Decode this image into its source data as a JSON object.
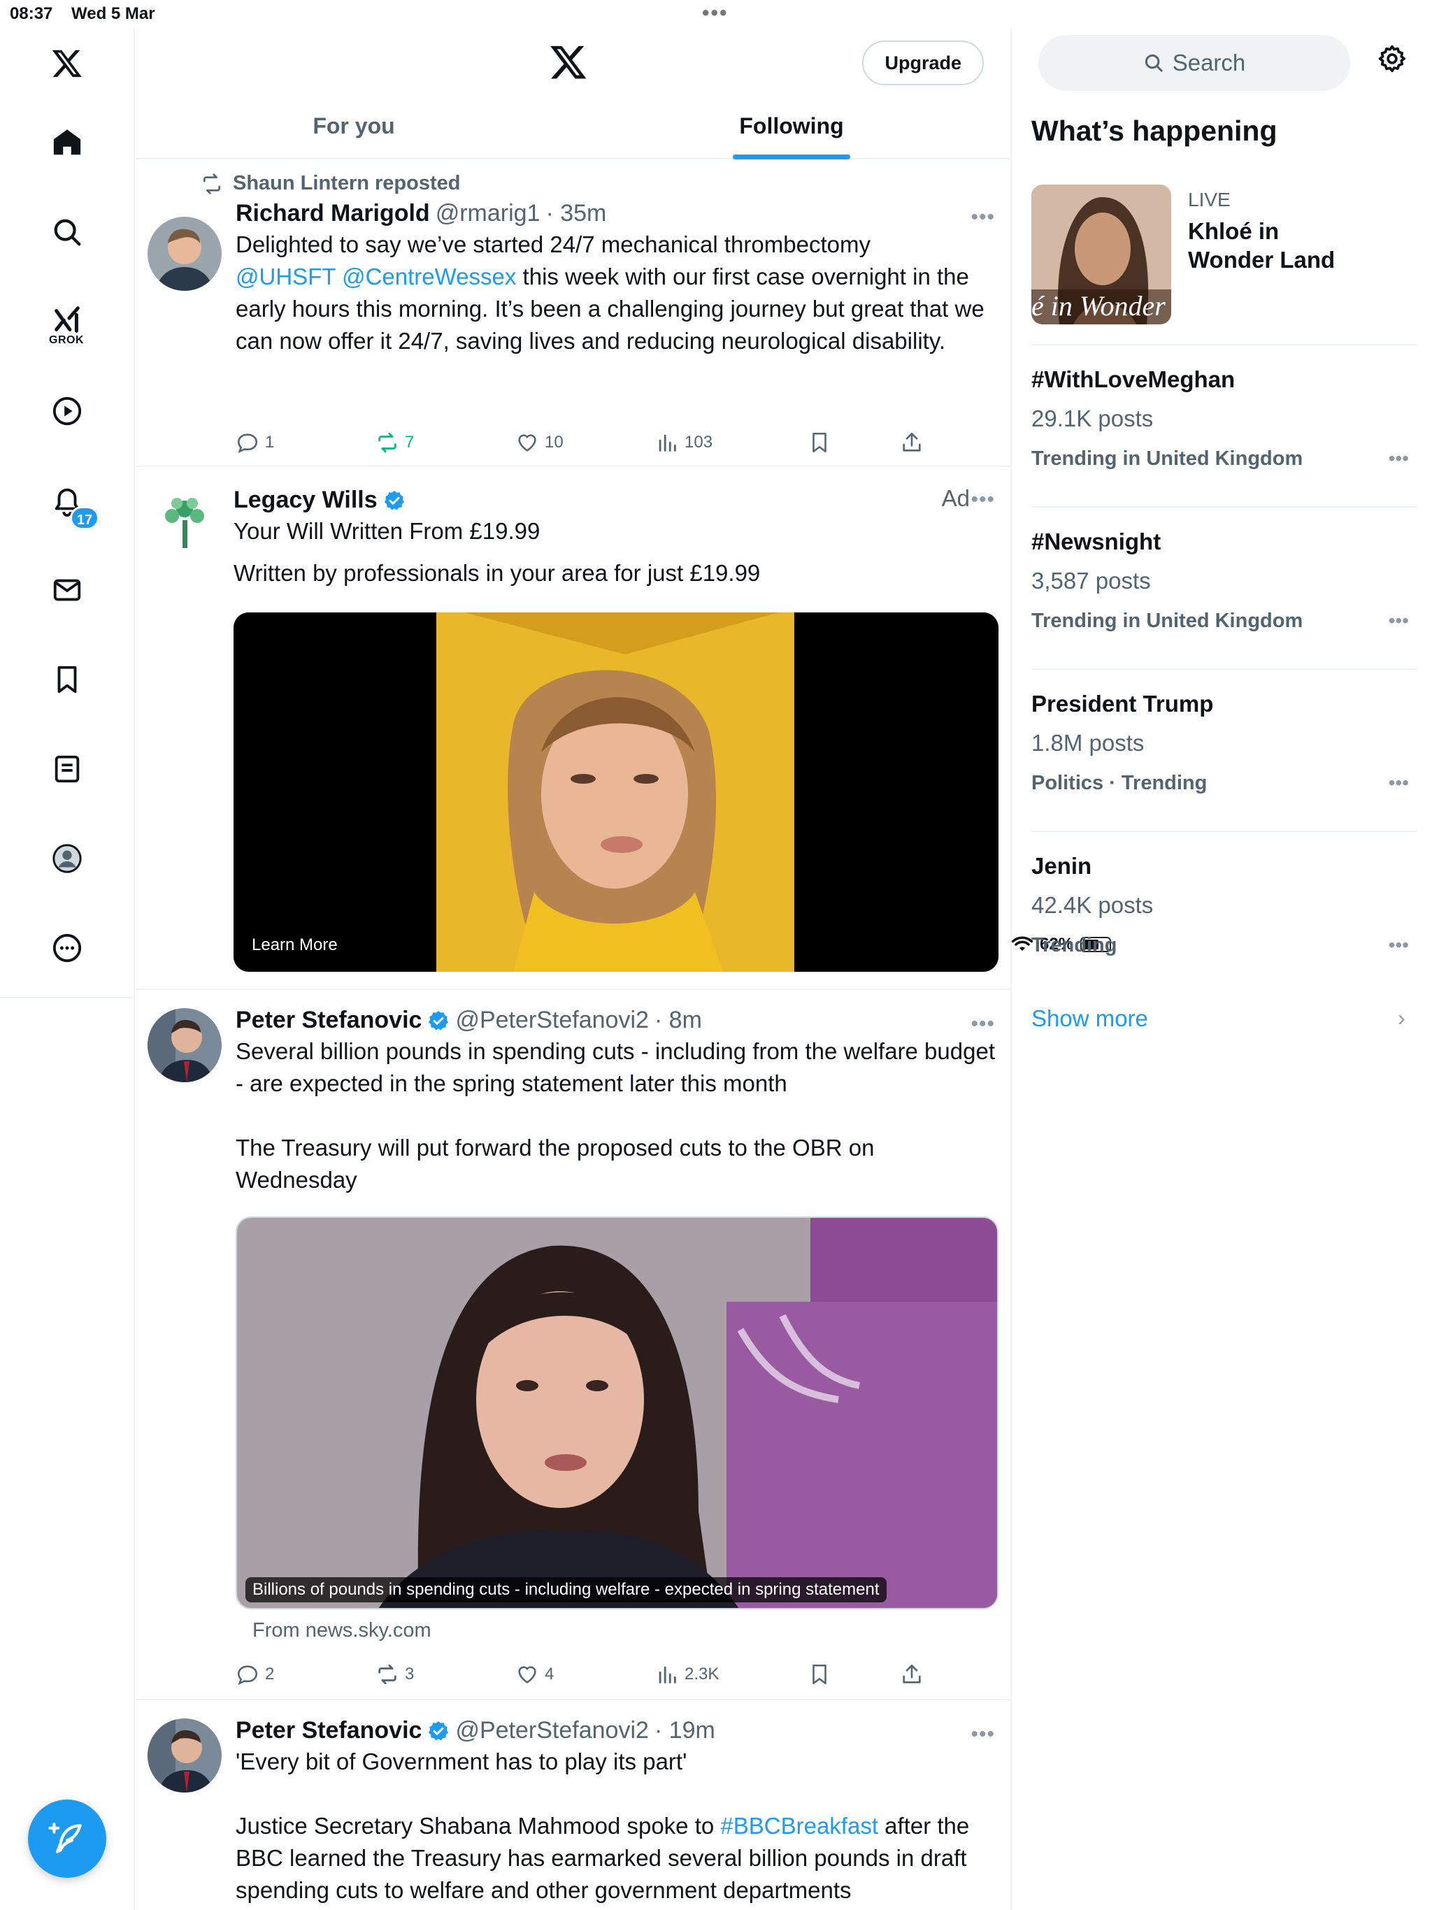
{
  "status": {
    "time": "08:37",
    "date": "Wed 5 Mar",
    "battery": "62%",
    "battery_level": 0.62
  },
  "nav": {
    "grok_label": "GROK",
    "notifications_badge": "17"
  },
  "header": {
    "upgrade_label": "Upgrade"
  },
  "tabs": [
    {
      "label": "For you"
    },
    {
      "label": "Following"
    }
  ],
  "tweets": [
    {
      "repost_by": "Shaun Lintern reposted",
      "name": "Richard Marigold",
      "handle": "@rmarig1",
      "time": "· 35m",
      "text_a": "Delighted to say we’ve started 24/7 mechanical thrombectomy",
      "mention1": "@UHSFT",
      "mention2": "@CentreWessex",
      "text_b": " this week with our first case overnight in the early hours this morning. It’s been a challenging journey but great that we can now offer it 24/7, saving lives and reducing neurological disability.",
      "replies": "1",
      "reposts": "7",
      "likes": "10",
      "views": "103"
    },
    {
      "name": "Legacy Wills",
      "ad_label": "Ad",
      "headline": "Your Will Written From £19.99",
      "text": "Written by professionals in your area for just £19.99",
      "cta": "Learn More"
    },
    {
      "name": "Peter Stefanovic",
      "handle": "@PeterStefanovi2",
      "time": "· 8m",
      "text_a": "Several billion pounds in spending cuts - including from the welfare budget - are expected in the spring statement later this month",
      "text_b": "The Treasury will put forward the proposed cuts to the OBR on Wednesday",
      "media_caption": "Billions of pounds in spending cuts - including welfare - expected in spring statement",
      "source": "From news.sky.com",
      "replies": "2",
      "reposts": "3",
      "likes": "4",
      "views": "2.3K"
    },
    {
      "name": "Peter Stefanovic",
      "handle": "@PeterStefanovi2",
      "time": "· 19m",
      "text_a": "'Every bit of Government has to play its part'",
      "text_b1": "Justice Secretary Shabana Mahmood spoke to ",
      "hashtag": "#BBCBreakfast",
      "text_b2": " after the BBC learned the Treasury has earmarked several billion pounds in draft spending cuts to welfare and other government departments"
    }
  ],
  "sidebar": {
    "search_placeholder": "Search",
    "title": "What’s happening",
    "live": {
      "tag": "LIVE",
      "title": "Khloé in Wonder Land",
      "image_text": "é in Wonder l"
    },
    "trends": [
      {
        "name": "#WithLoveMeghan",
        "posts": "29.1K posts",
        "meta": "Trending in United Kingdom"
      },
      {
        "name": "#Newsnight",
        "posts": "3,587 posts",
        "meta": "Trending in United Kingdom"
      },
      {
        "name": "President Trump",
        "posts": "1.8M posts",
        "meta": "Politics · Trending"
      },
      {
        "name": "Jenin",
        "posts": "42.4K posts",
        "meta": "Trending"
      }
    ],
    "show_more": "Show more"
  },
  "colors": {
    "accent": "#1d9bf0",
    "repost_green": "#00ba7c",
    "muted": "#536471"
  }
}
